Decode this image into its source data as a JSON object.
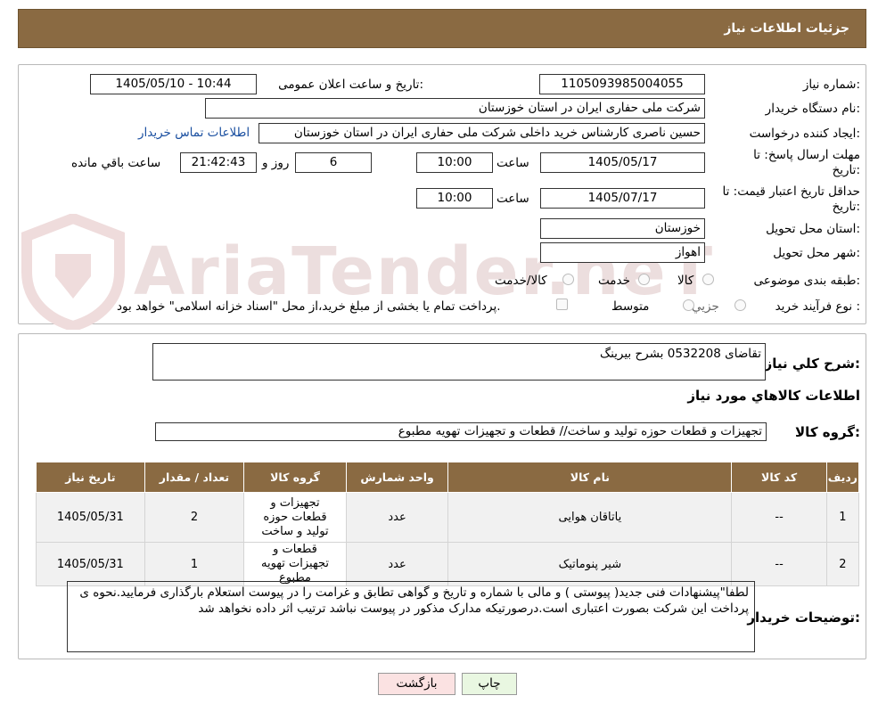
{
  "page_title": "جزئیات اطلاعات نیاز",
  "labels": {
    "need_number": "شماره نیاز:",
    "announce_datetime": "تاریخ و ساعت اعلان عمومی:",
    "buyer_org": "نام دستگاه خریدار:",
    "requester": "ایجاد کننده درخواست:",
    "contact_link": "اطلاعات تماس خریدار",
    "deadline_line1": "مهلت ارسال پاسخ: تا",
    "deadline_line2": "تاریخ:",
    "validity_line1": "حداقل تاریخ اعتبار قیمت: تا",
    "validity_line2": "تاریخ:",
    "time": "ساعت",
    "day_and": "روز و",
    "remaining": "ساعت باقي مانده",
    "province": "استان محل تحویل:",
    "city": "شهر محل تحویل:",
    "category": "طبقه بندی موضوعی:",
    "process_type": "نوع فرآیند خرید :",
    "general_desc": "شرح کلي نياز:",
    "goods_info": "اطلاعات کالاهاي مورد نياز",
    "goods_group": "گروه کالا:",
    "buyer_notes": "توضيحات خريدار:"
  },
  "values": {
    "need_number": "1105093985004055",
    "announce_datetime": "1405/05/10 - 10:44",
    "buyer_org": "شرکت ملی حفاری ایران در استان خوزستان",
    "requester": "حسین ناصری کارشناس خرید داخلی شرکت ملی حفاری ایران در استان خوزستان",
    "deadline_date": "1405/05/17",
    "deadline_time": "10:00",
    "days_left": "6",
    "time_left": "21:42:43",
    "validity_date": "1405/07/17",
    "validity_time": "10:00",
    "province": "خوزستان",
    "city": "اهواز",
    "general_desc": "تقاضای 0532208 بشرح بیرینگ",
    "goods_group": "تجهیزات و قطعات حوزه تولید و ساخت//  قطعات و تجهیزات تهویه مطبوع",
    "buyer_notes": "لطفا\"پیشنهادات فنی جدید( پیوستی ) و مالی با شماره و تاریخ و گواهی تطابق و غرامت را در پیوست استعلام بارگذاری فرمایید.نحوه ی پرداخت این شرکت بصورت اعتباری است.درصورتیکه مدارک مذکور در پیوست نباشد ترتیب اثر داده نخواهد شد"
  },
  "category_options": [
    "کالا",
    "خدمت",
    "کالا/خدمت"
  ],
  "process_options": [
    "جزیي",
    "متوسط"
  ],
  "treasury_note": "پرداخت تمام یا بخشی از مبلغ خرید،از محل \"اسناد خزانه اسلامی\" خواهد بود.",
  "table": {
    "headers": [
      "رديف",
      "کد کالا",
      "نام کالا",
      "واحد شمارش",
      "گروه کالا",
      "تعداد / مقدار",
      "تاریخ نیاز"
    ],
    "rows": [
      [
        "1",
        "--",
        "یاتاقان هوایی",
        "عدد",
        "تجهیزات و قطعات حوزه تولید و ساخت",
        "2",
        "1405/05/31"
      ],
      [
        "2",
        "--",
        "شیر پنوماتیک",
        "عدد",
        "قطعات و تجهیزات تهویه مطبوع",
        "1",
        "1405/05/31"
      ]
    ]
  },
  "buttons": {
    "print": "چاپ",
    "back": "بازگشت"
  },
  "watermark": "AriaTender.neT",
  "colors": {
    "header": "#8a6a42",
    "link": "#1a4fa0",
    "back_button": "#fbe2e2",
    "print_button": "#e9f7e1"
  }
}
